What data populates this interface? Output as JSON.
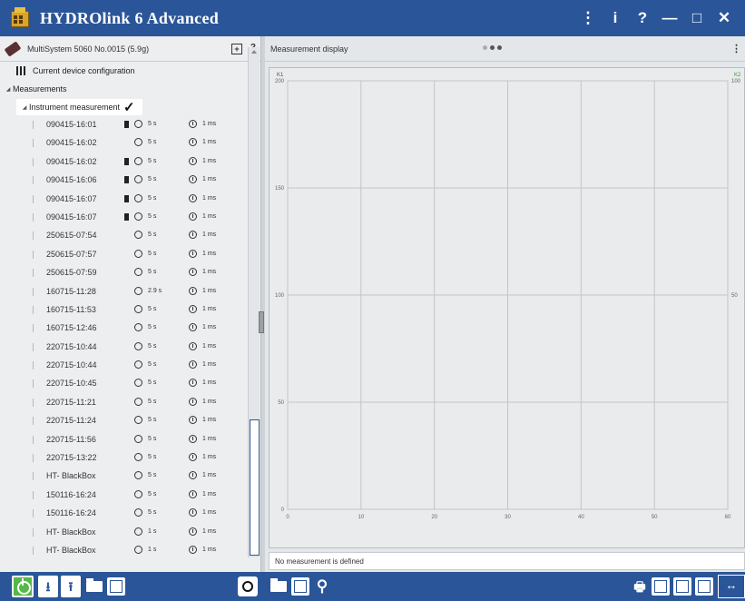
{
  "window": {
    "title": "HYDROlink 6 Advanced",
    "controls": [
      "⋮",
      "i",
      "?",
      "—",
      "□",
      "✕"
    ]
  },
  "left_panel": {
    "device": "MultiSystem 5060 No.0015 (5.9g)",
    "tree": {
      "config_label": "Current device configuration",
      "measurements_label": "Measurements",
      "instrument_label": "Instrument measurement",
      "items": [
        {
          "name": "090415-16:01",
          "bookmark": true,
          "duration": "5 s",
          "rate": "1 ms"
        },
        {
          "name": "090415-16:02",
          "bookmark": false,
          "duration": "5 s",
          "rate": "1 ms"
        },
        {
          "name": "090415-16:02",
          "bookmark": true,
          "duration": "5 s",
          "rate": "1 ms"
        },
        {
          "name": "090415-16:06",
          "bookmark": true,
          "duration": "5 s",
          "rate": "1 ms"
        },
        {
          "name": "090415-16:07",
          "bookmark": true,
          "duration": "5 s",
          "rate": "1 ms"
        },
        {
          "name": "090415-16:07",
          "bookmark": true,
          "duration": "5 s",
          "rate": "1 ms"
        },
        {
          "name": "250615-07:54",
          "bookmark": false,
          "duration": "5 s",
          "rate": "1 ms"
        },
        {
          "name": "250615-07:57",
          "bookmark": false,
          "duration": "5 s",
          "rate": "1 ms"
        },
        {
          "name": "250615-07:59",
          "bookmark": false,
          "duration": "5 s",
          "rate": "1 ms"
        },
        {
          "name": "160715-11:28",
          "bookmark": false,
          "duration": "2.9 s",
          "rate": "1 ms"
        },
        {
          "name": "160715-11:53",
          "bookmark": false,
          "duration": "5 s",
          "rate": "1 ms"
        },
        {
          "name": "160715-12:46",
          "bookmark": false,
          "duration": "5 s",
          "rate": "1 ms"
        },
        {
          "name": "220715-10:44",
          "bookmark": false,
          "duration": "5 s",
          "rate": "1 ms"
        },
        {
          "name": "220715-10:44",
          "bookmark": false,
          "duration": "5 s",
          "rate": "1 ms"
        },
        {
          "name": "220715-10:45",
          "bookmark": false,
          "duration": "5 s",
          "rate": "1 ms"
        },
        {
          "name": "220715-11:21",
          "bookmark": false,
          "duration": "5 s",
          "rate": "1 ms"
        },
        {
          "name": "220715-11:24",
          "bookmark": false,
          "duration": "5 s",
          "rate": "1 ms"
        },
        {
          "name": "220715-11:56",
          "bookmark": false,
          "duration": "5 s",
          "rate": "1 ms"
        },
        {
          "name": "220715-13:22",
          "bookmark": false,
          "duration": "5 s",
          "rate": "1 ms"
        },
        {
          "name": "HT- BlackBox",
          "bookmark": false,
          "duration": "5 s",
          "rate": "1 ms"
        },
        {
          "name": "150116-16:24",
          "bookmark": false,
          "duration": "5 s",
          "rate": "1 ms"
        },
        {
          "name": "150116-16:24",
          "bookmark": false,
          "duration": "5 s",
          "rate": "1 ms"
        },
        {
          "name": "HT- BlackBox",
          "bookmark": false,
          "duration": "1 s",
          "rate": "1 ms"
        },
        {
          "name": "HT- BlackBox",
          "bookmark": false,
          "duration": "1 s",
          "rate": "1 ms"
        }
      ]
    }
  },
  "right_panel": {
    "title": "Measurement display",
    "chart": {
      "left_axis_label": "K1",
      "right_axis_label": "K2",
      "left_ticks": [
        "200",
        "150",
        "100",
        "50",
        "0"
      ],
      "right_ticks": [
        "100",
        "50"
      ],
      "x_ticks": [
        "0",
        "10",
        "20",
        "30",
        "40",
        "50",
        "60"
      ]
    },
    "status": "No measurement is defined"
  },
  "colors": {
    "brand": "#2a5598",
    "power": "#56b84a"
  }
}
